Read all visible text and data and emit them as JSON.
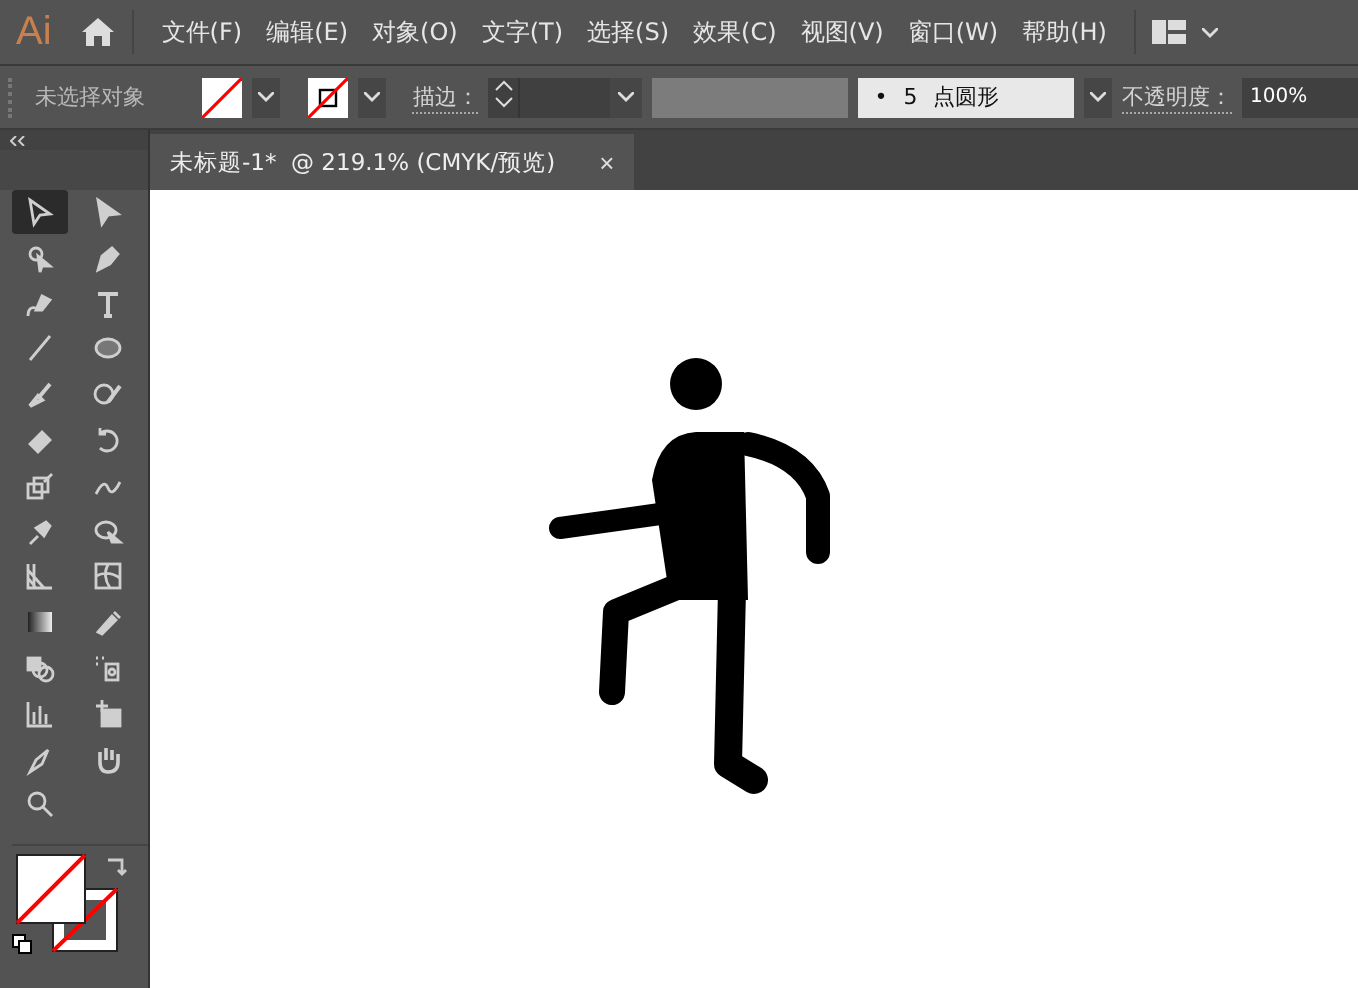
{
  "app": {
    "logo": "Ai"
  },
  "menu": [
    {
      "label": "文件(F)"
    },
    {
      "label": "编辑(E)"
    },
    {
      "label": "对象(O)"
    },
    {
      "label": "文字(T)"
    },
    {
      "label": "选择(S)"
    },
    {
      "label": "效果(C)"
    },
    {
      "label": "视图(V)"
    },
    {
      "label": "窗口(W)"
    },
    {
      "label": "帮助(H)"
    }
  ],
  "control_bar": {
    "status": "未选择对象",
    "stroke_label": "描边：",
    "brush": {
      "dot": "•",
      "value": "5",
      "label": "点圆形"
    },
    "opacity_label": "不透明度：",
    "opacity_value": "100%"
  },
  "document_tab": {
    "title": "未标题-1*  @ 219.1% (CMYK/预览)",
    "close": "×",
    "selected": true
  },
  "tools": [
    {
      "kind": "select",
      "selected": true
    },
    {
      "kind": "direct",
      "selected": false
    },
    {
      "kind": "magic",
      "selected": false
    },
    {
      "kind": "pen",
      "selected": false
    },
    {
      "kind": "curvature",
      "selected": false
    },
    {
      "kind": "type",
      "selected": false
    },
    {
      "kind": "line",
      "selected": false
    },
    {
      "kind": "ellipse",
      "selected": false
    },
    {
      "kind": "brush",
      "selected": false
    },
    {
      "kind": "blob",
      "selected": false
    },
    {
      "kind": "eraser",
      "selected": false
    },
    {
      "kind": "rotate",
      "selected": false
    },
    {
      "kind": "scale",
      "selected": false
    },
    {
      "kind": "warp",
      "selected": false
    },
    {
      "kind": "pin",
      "selected": false
    },
    {
      "kind": "builder",
      "selected": false
    },
    {
      "kind": "perspective",
      "selected": false
    },
    {
      "kind": "mesh",
      "selected": false
    },
    {
      "kind": "gradient",
      "selected": false
    },
    {
      "kind": "eyedropper",
      "selected": false
    },
    {
      "kind": "blend",
      "selected": false
    },
    {
      "kind": "spray",
      "selected": false
    },
    {
      "kind": "graph",
      "selected": false
    },
    {
      "kind": "artboard",
      "selected": false
    },
    {
      "kind": "slice",
      "selected": false
    },
    {
      "kind": "hand",
      "selected": false
    },
    {
      "kind": "zoom",
      "selected": false
    }
  ]
}
